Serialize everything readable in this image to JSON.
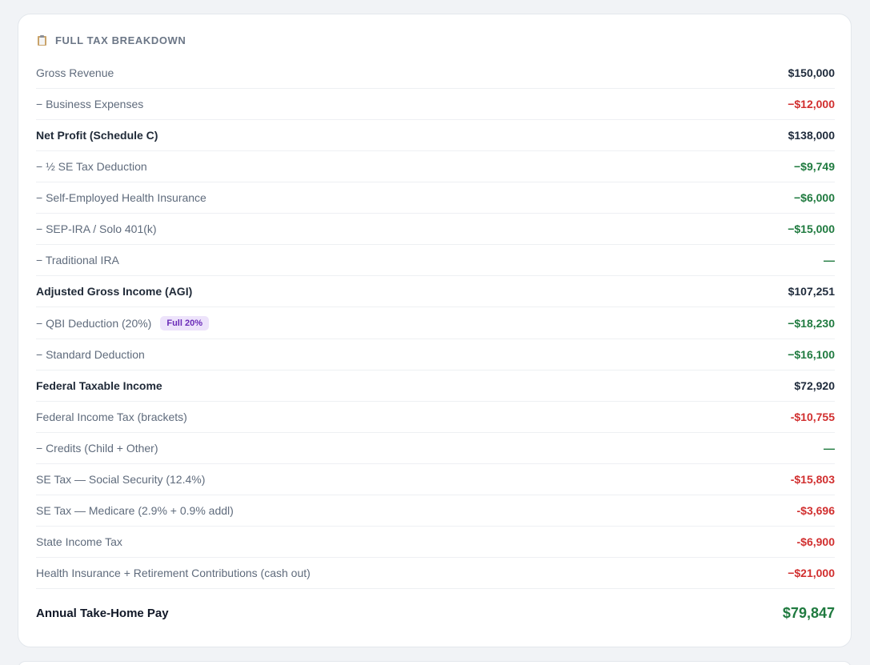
{
  "card": {
    "icon": "clipboard-icon",
    "title": "Full Tax Breakdown"
  },
  "rows": [
    {
      "label": "Gross Revenue",
      "value": "$150,000",
      "tone": "neutral",
      "strong": false
    },
    {
      "label": "− Business Expenses",
      "value": "−$12,000",
      "tone": "red",
      "strong": false
    },
    {
      "label": "Net Profit (Schedule C)",
      "value": "$138,000",
      "tone": "neutral",
      "strong": true
    },
    {
      "label": "− ½ SE Tax Deduction",
      "value": "−$9,749",
      "tone": "green",
      "strong": false
    },
    {
      "label": "− Self-Employed Health Insurance",
      "value": "−$6,000",
      "tone": "green",
      "strong": false
    },
    {
      "label": "− SEP-IRA / Solo 401(k)",
      "value": "−$15,000",
      "tone": "green",
      "strong": false
    },
    {
      "label": "− Traditional IRA",
      "value": "—",
      "tone": "green",
      "strong": false
    },
    {
      "label": "Adjusted Gross Income (AGI)",
      "value": "$107,251",
      "tone": "neutral",
      "strong": true
    },
    {
      "label": "− QBI Deduction (20%)",
      "value": "−$18,230",
      "tone": "green",
      "strong": false,
      "badge": "Full 20%"
    },
    {
      "label": "− Standard Deduction",
      "value": "−$16,100",
      "tone": "green",
      "strong": false
    },
    {
      "label": "Federal Taxable Income",
      "value": "$72,920",
      "tone": "neutral",
      "strong": true
    },
    {
      "label": "Federal Income Tax (brackets)",
      "value": "-$10,755",
      "tone": "red",
      "strong": false
    },
    {
      "label": "− Credits (Child + Other)",
      "value": "—",
      "tone": "green",
      "strong": false
    },
    {
      "label": "SE Tax — Social Security (12.4%)",
      "value": "-$15,803",
      "tone": "red",
      "strong": false
    },
    {
      "label": "SE Tax — Medicare (2.9% + 0.9% addl)",
      "value": "-$3,696",
      "tone": "red",
      "strong": false
    },
    {
      "label": "State Income Tax",
      "value": "-$6,900",
      "tone": "red",
      "strong": false
    },
    {
      "label": "Health Insurance + Retirement Contributions (cash out)",
      "value": "−$21,000",
      "tone": "red",
      "strong": false
    }
  ],
  "total": {
    "label": "Annual Take-Home Pay",
    "value": "$79,847"
  },
  "colors": {
    "neutral": "#1e2a3b",
    "red": "#d12f2f",
    "green": "#1f7a3f",
    "badge_bg": "#ede3fb",
    "badge_text": "#6a2bb8"
  }
}
